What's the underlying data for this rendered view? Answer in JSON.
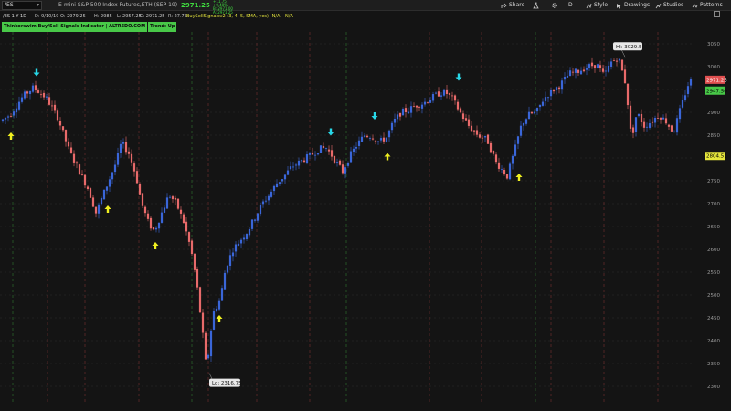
{
  "header": {
    "symbol": "/ES",
    "description": "E-mini S&P 500 Index Futures,ETH (SEP 19)",
    "last_price": "2971.25",
    "change_line1": "+11.75",
    "change_line2": "+0.40%",
    "change_line3": "B: 2971.00",
    "change_line4": "A: 2971.25",
    "toolbar": {
      "share": "Share",
      "timeframe": "D",
      "style": "Style",
      "drawings": "Drawings",
      "studies": "Studies",
      "patterns": "Patterns"
    }
  },
  "info_row": {
    "aggregation": "/ES 1 Y 1D",
    "date": "D: 9/10/19",
    "open": "O: 2979.25",
    "high": "H: 2985",
    "low": "L: 2957.25",
    "close": "C: 2971.25",
    "range": "R: 27.75"
  },
  "study": {
    "name": "BuySellSignalsv2 (3, 4, 5, SMA, yes)",
    "value1": "N/A",
    "value2": "N/A"
  },
  "indicator": {
    "title": "Thinkorswim Buy/Sell Signals Indicator | ALTREDO.COM",
    "trend": "Trend: Up"
  },
  "callouts": {
    "high": "Hi: 3029.5",
    "low": "Lo: 2316.75"
  },
  "price_axis": {
    "ticks": [
      "3050",
      "3000",
      "2950",
      "2900",
      "2850",
      "2800",
      "2750",
      "2700",
      "2650",
      "2600",
      "2550",
      "2500",
      "2450",
      "2400",
      "2350",
      "2300"
    ],
    "badges": [
      {
        "label": "2971.25",
        "color": "#e05050",
        "text_color": "#ffffff",
        "price": 2971.25
      },
      {
        "label": "2947.50",
        "color": "#48c848",
        "text_color": "#000000",
        "price": 2947.5
      },
      {
        "label": "2804.51",
        "color": "#e6e63c",
        "text_color": "#000000",
        "price": 2804.51
      }
    ]
  },
  "colors": {
    "up_candle": "#3a66d8",
    "down_candle": "#e86a6a",
    "buy_arrow": "#f0f020",
    "sell_arrow": "#28d8e8",
    "grid": "#2e2e2e"
  }
}
